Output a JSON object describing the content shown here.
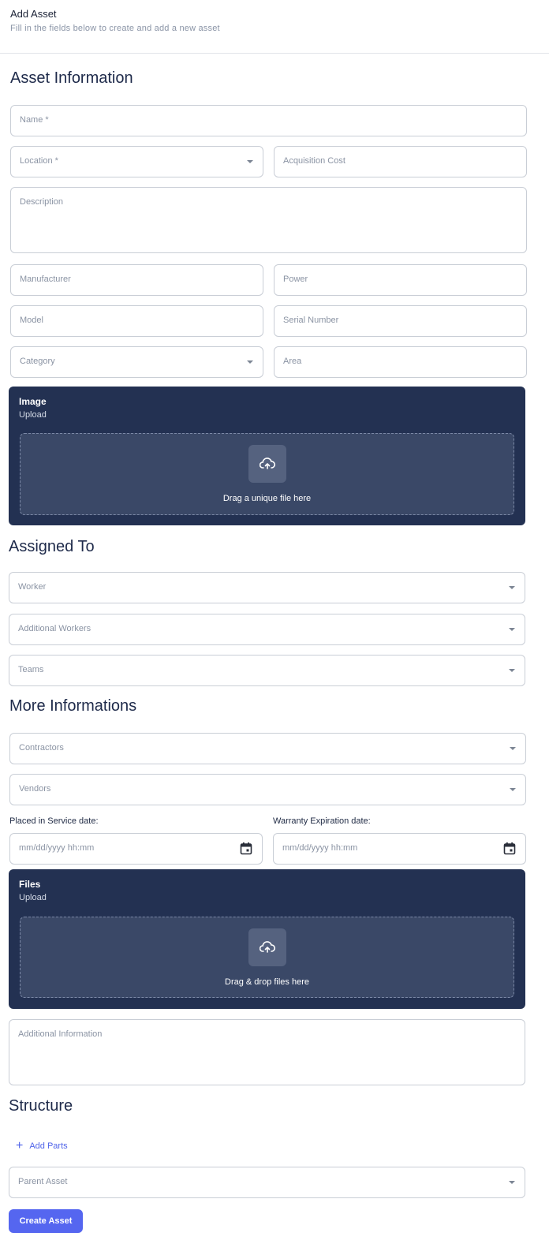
{
  "header": {
    "title": "Add Asset",
    "subtitle": "Fill in the fields below to create and add a new asset"
  },
  "asset_info": {
    "title": "Asset Information",
    "name_placeholder": "Name *",
    "location_placeholder": "Location *",
    "acquisition_cost_placeholder": "Acquisition Cost",
    "description_placeholder": "Description",
    "manufacturer_placeholder": "Manufacturer",
    "power_placeholder": "Power",
    "model_placeholder": "Model",
    "serial_number_placeholder": "Serial Number",
    "category_placeholder": "Category",
    "area_placeholder": "Area"
  },
  "image_upload": {
    "title": "Image",
    "subtitle": "Upload",
    "drop_text": "Drag a unique file here",
    "icon": "cloud-upload-icon"
  },
  "assigned_to": {
    "title": "Assigned To",
    "worker_placeholder": "Worker",
    "additional_workers_placeholder": "Additional Workers",
    "teams_placeholder": "Teams"
  },
  "more_info": {
    "title": "More Informations",
    "contractors_placeholder": "Contractors",
    "vendors_placeholder": "Vendors",
    "placed_in_service_label": "Placed in Service date:",
    "placed_in_service_placeholder": "mm/dd/yyyy hh:mm",
    "warranty_label": "Warranty Expiration date:",
    "warranty_placeholder": "mm/dd/yyyy hh:mm",
    "date_icon": "calendar-icon"
  },
  "files_upload": {
    "title": "Files",
    "subtitle": "Upload",
    "drop_text": "Drag & drop files here",
    "icon": "cloud-upload-icon"
  },
  "additional_info_placeholder": "Additional Information",
  "structure": {
    "title": "Structure",
    "add_parts_label": "Add Parts",
    "parent_asset_placeholder": "Parent Asset"
  },
  "create_button_label": "Create Asset",
  "colors": {
    "panel_bg": "#233152",
    "dropzone_bg": "#3a4867",
    "primary": "#5566f0",
    "link": "#4f63e9"
  }
}
